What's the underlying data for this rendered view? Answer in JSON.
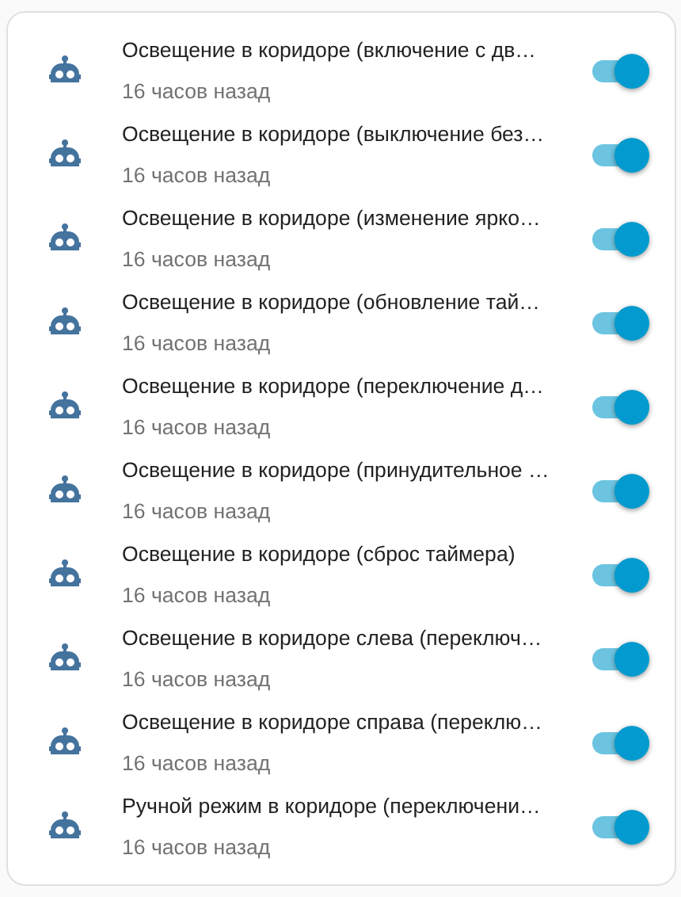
{
  "automations": [
    {
      "name": "Освещение в коридоре (включение с дв…",
      "last_triggered": "16 часов назад",
      "on": true
    },
    {
      "name": "Освещение в коридоре (выключение без…",
      "last_triggered": "16 часов назад",
      "on": true
    },
    {
      "name": "Освещение в коридоре (изменение ярко…",
      "last_triggered": "16 часов назад",
      "on": true
    },
    {
      "name": "Освещение в коридоре (обновление тай…",
      "last_triggered": "16 часов назад",
      "on": true
    },
    {
      "name": "Освещение в коридоре (переключение д…",
      "last_triggered": "16 часов назад",
      "on": true
    },
    {
      "name": "Освещение в коридоре (принудительное …",
      "last_triggered": "16 часов назад",
      "on": true
    },
    {
      "name": "Освещение в коридоре (сброс таймера)",
      "last_triggered": "16 часов назад",
      "on": true
    },
    {
      "name": "Освещение в коридоре слева (переключ…",
      "last_triggered": "16 часов назад",
      "on": true
    },
    {
      "name": "Освещение в коридоре справа (переклю…",
      "last_triggered": "16 часов назад",
      "on": true
    },
    {
      "name": "Ручной режим в коридоре (переключени…",
      "last_triggered": "16 часов назад",
      "on": true
    }
  ]
}
